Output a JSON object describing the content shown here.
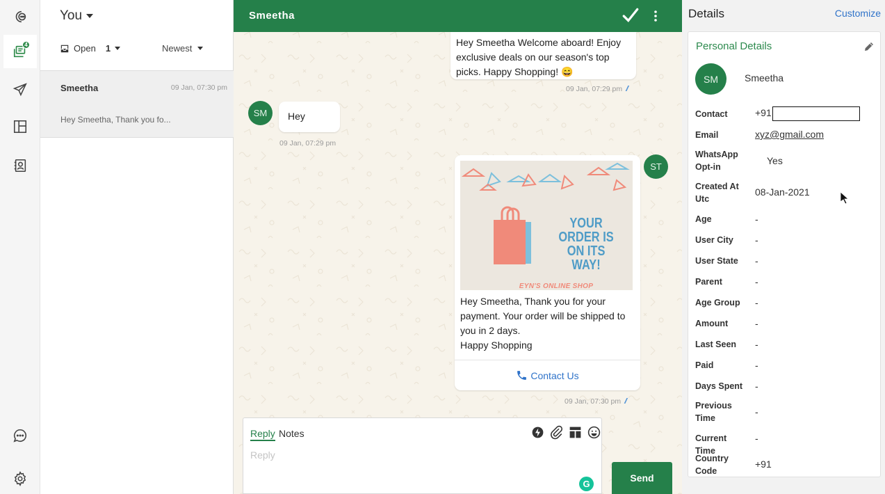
{
  "sidebar": {
    "inbox_badge": "4"
  },
  "conversation_list": {
    "owner_label": "You",
    "status_filter": "Open",
    "status_count": "1",
    "sort_label": "Newest",
    "items": [
      {
        "name": "Smeetha",
        "time": "09 Jan, 07:30 pm",
        "preview": "Hey Smeetha, Thank you fo..."
      }
    ]
  },
  "chat": {
    "title": "Smeetha",
    "messages": [
      {
        "direction": "out",
        "text": "Hey Smeetha Welcome aboard! Enjoy exclusive deals on our season's top picks. Happy Shopping! 😄",
        "time": "09 Jan, 07:29 pm"
      },
      {
        "direction": "in",
        "avatar": "SM",
        "text": "Hey",
        "time": "09 Jan, 07:29 pm"
      },
      {
        "direction": "out",
        "avatar": "ST",
        "image": {
          "headline": "YOUR ORDER IS ON ITS WAY!",
          "shop_name": "EYN'S ONLINE SHOP"
        },
        "text": "Hey Smeetha, Thank you for your payment. Your order will be shipped to you in 2 days.",
        "text2": "Happy Shopping",
        "button": "Contact Us",
        "time": "09 Jan, 07:30 pm"
      }
    ],
    "composer": {
      "tab_reply": "Reply",
      "tab_notes": "Notes",
      "placeholder": "Reply",
      "send_label": "Send"
    }
  },
  "details": {
    "title": "Details",
    "customize": "Customize",
    "section_title": "Personal Details",
    "avatar": "SM",
    "name": "Smeetha",
    "fields": [
      {
        "label": "Contact",
        "value": "+91"
      },
      {
        "label": "Email",
        "value": "xyz@gmail.com"
      },
      {
        "label": "WhatsApp Opt-in",
        "value": "Yes"
      },
      {
        "label": "Created At Utc",
        "value": "08-Jan-2021"
      },
      {
        "label": "Age",
        "value": "-"
      },
      {
        "label": "User City",
        "value": "-"
      },
      {
        "label": "User State",
        "value": "-"
      },
      {
        "label": "Parent",
        "value": "-"
      },
      {
        "label": "Age Group",
        "value": "-"
      },
      {
        "label": "Amount",
        "value": "-"
      },
      {
        "label": "Last Seen",
        "value": "-"
      },
      {
        "label": "Paid",
        "value": "-"
      },
      {
        "label": "Days Spent",
        "value": "-"
      },
      {
        "label": "Previous Time",
        "value": "-"
      },
      {
        "label": "Current Time",
        "value": "-"
      },
      {
        "label": "Country Code",
        "value": "+91"
      }
    ]
  },
  "colors": {
    "brand_green": "#25804a",
    "link_blue": "#2f73c9",
    "chat_bg": "#f7f3ea"
  }
}
